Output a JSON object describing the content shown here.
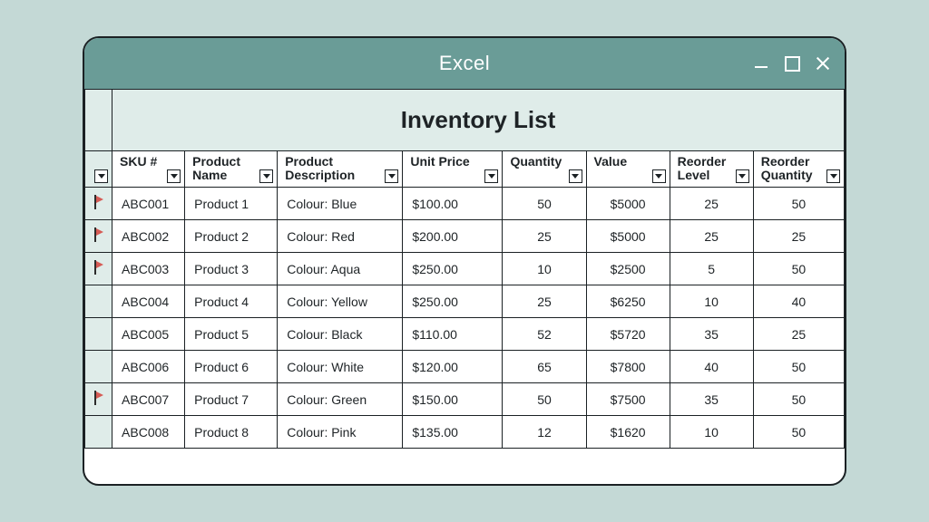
{
  "window": {
    "title": "Excel"
  },
  "sheet": {
    "title": "Inventory List",
    "columns": {
      "sku": "SKU #",
      "product_name": "Product Name",
      "product_description": "Product Description",
      "unit_price": "Unit Price",
      "quantity": "Quantity",
      "value": "Value",
      "reorder_level": "Reorder Level",
      "reorder_quantity": "Reorder Quantity"
    },
    "rows": [
      {
        "flag": true,
        "sku": "ABC001",
        "product_name": "Product 1",
        "product_description": "Colour: Blue",
        "unit_price": "$100.00",
        "quantity": "50",
        "value": "$5000",
        "reorder_level": "25",
        "reorder_quantity": "50"
      },
      {
        "flag": true,
        "sku": "ABC002",
        "product_name": "Product 2",
        "product_description": "Colour: Red",
        "unit_price": "$200.00",
        "quantity": "25",
        "value": "$5000",
        "reorder_level": "25",
        "reorder_quantity": "25"
      },
      {
        "flag": true,
        "sku": "ABC003",
        "product_name": "Product 3",
        "product_description": "Colour: Aqua",
        "unit_price": "$250.00",
        "quantity": "10",
        "value": "$2500",
        "reorder_level": "5",
        "reorder_quantity": "50"
      },
      {
        "flag": false,
        "sku": "ABC004",
        "product_name": "Product 4",
        "product_description": "Colour: Yellow",
        "unit_price": "$250.00",
        "quantity": "25",
        "value": "$6250",
        "reorder_level": "10",
        "reorder_quantity": "40"
      },
      {
        "flag": false,
        "sku": "ABC005",
        "product_name": "Product 5",
        "product_description": "Colour: Black",
        "unit_price": "$110.00",
        "quantity": "52",
        "value": "$5720",
        "reorder_level": "35",
        "reorder_quantity": "25"
      },
      {
        "flag": false,
        "sku": "ABC006",
        "product_name": "Product 6",
        "product_description": "Colour: White",
        "unit_price": "$120.00",
        "quantity": "65",
        "value": "$7800",
        "reorder_level": "40",
        "reorder_quantity": "50"
      },
      {
        "flag": true,
        "sku": "ABC007",
        "product_name": "Product 7",
        "product_description": "Colour: Green",
        "unit_price": "$150.00",
        "quantity": "50",
        "value": "$7500",
        "reorder_level": "35",
        "reorder_quantity": "50"
      },
      {
        "flag": false,
        "sku": "ABC008",
        "product_name": "Product 8",
        "product_description": "Colour: Pink",
        "unit_price": "$135.00",
        "quantity": "12",
        "value": "$1620",
        "reorder_level": "10",
        "reorder_quantity": "50"
      }
    ]
  }
}
